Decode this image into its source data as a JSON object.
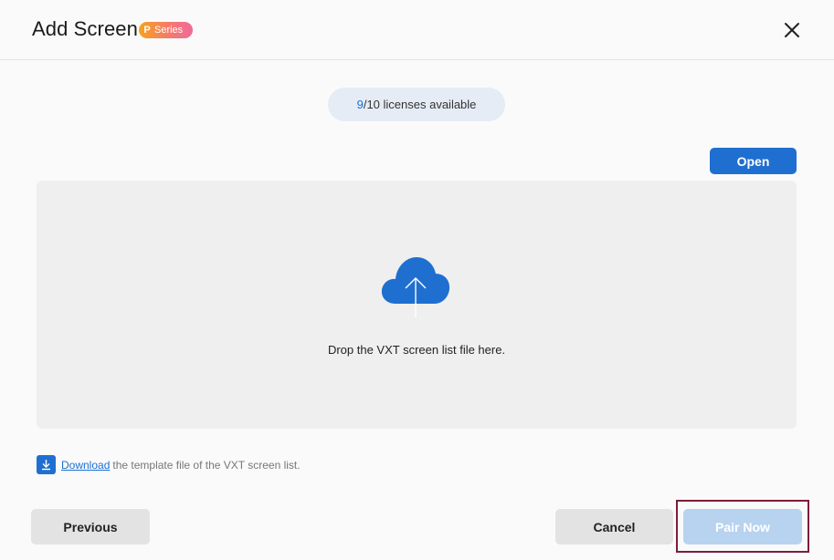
{
  "dialog": {
    "title": "Add Screen",
    "badge": {
      "letter": "P",
      "label": "Series"
    }
  },
  "licenses": {
    "available": "9",
    "rest": "/10 licenses available"
  },
  "open_label": "Open",
  "dropzone": {
    "icon": "cloud-upload-icon",
    "text": "Drop the VXT screen list file here."
  },
  "download": {
    "icon": "download-icon",
    "link_text": "Download",
    "rest": "the template file of the VXT screen list."
  },
  "footer": {
    "previous_label": "Previous",
    "cancel_label": "Cancel",
    "pair_label": "Pair Now",
    "pair_disabled": true
  },
  "colors": {
    "accent": "#1f6fd0",
    "disabled_button": "#b8d3f0",
    "highlight_frame": "#7a1e3c"
  }
}
